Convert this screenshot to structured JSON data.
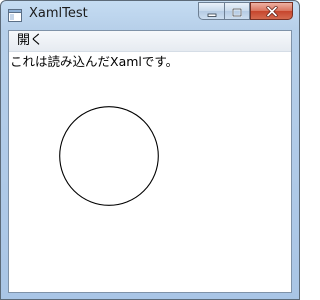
{
  "window": {
    "title": "XamlTest",
    "icon": "app-window-icon",
    "buttons": {
      "minimize": "minimize-icon",
      "maximize": "maximize-icon",
      "close": "close-icon"
    }
  },
  "menu": {
    "items": [
      {
        "label": "開く"
      }
    ]
  },
  "content": {
    "text": "これは読み込んだXamlです。",
    "shape": "ellipse"
  },
  "colors": {
    "frame": "#b6cfe9",
    "client_background": "#ffffff",
    "close_button": "#c6452d",
    "shape_stroke": "#000000"
  }
}
